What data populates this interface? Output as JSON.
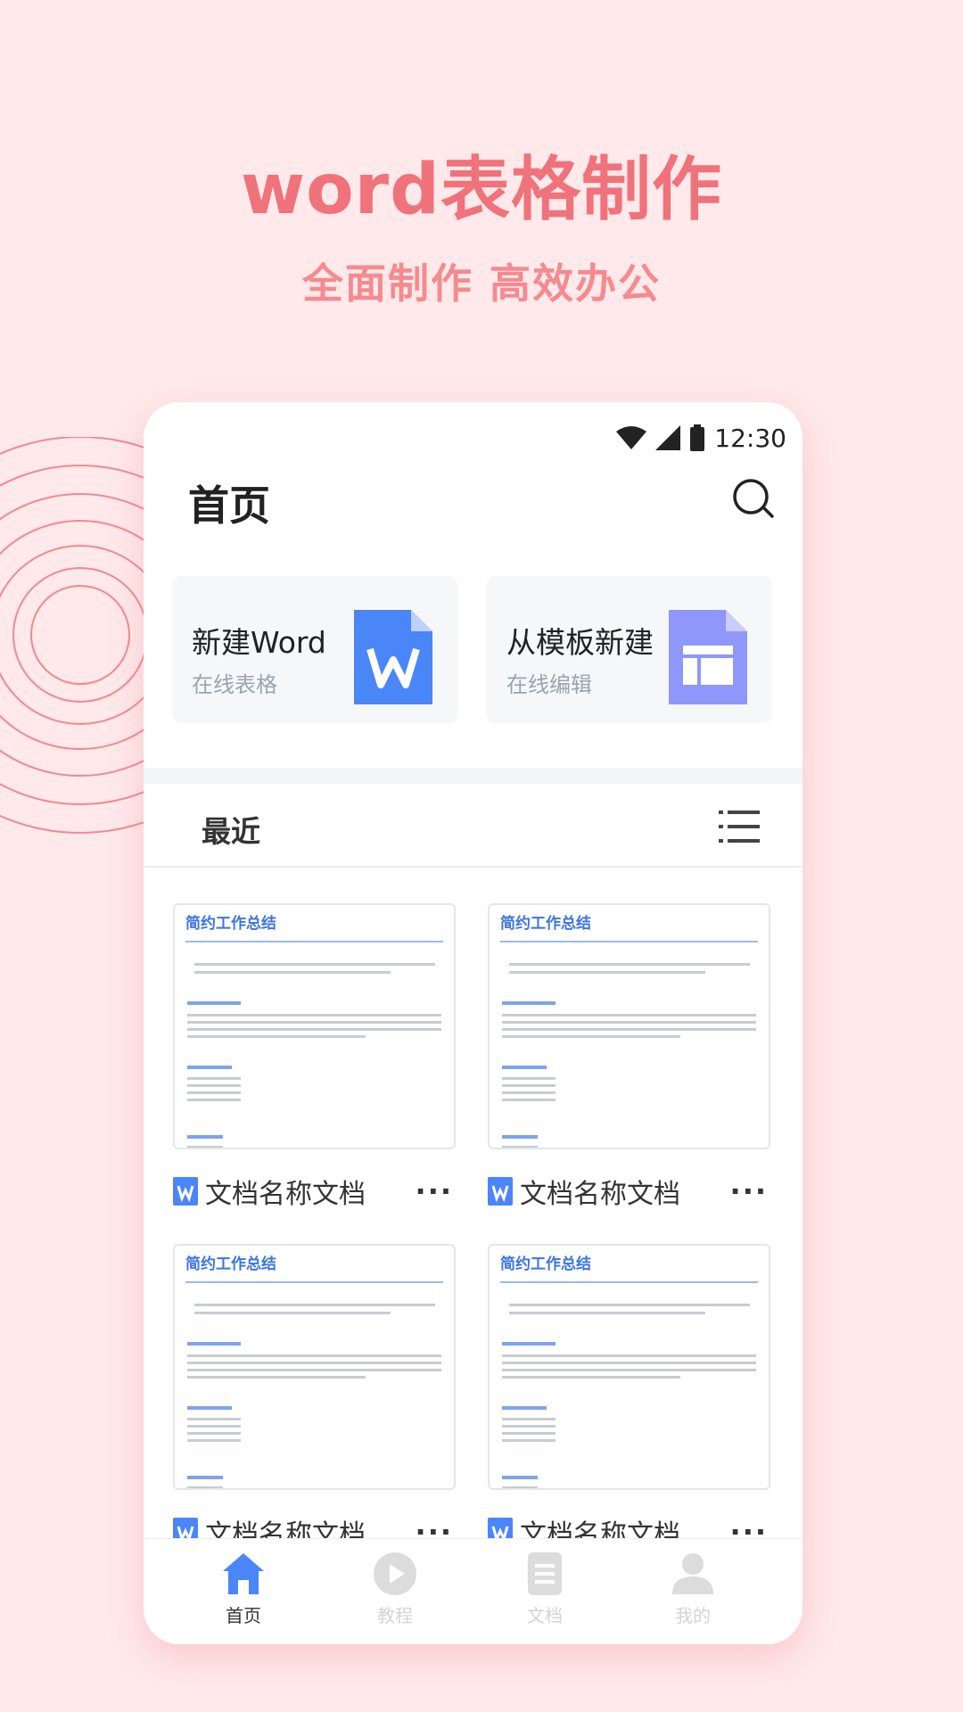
{
  "promo": {
    "headline": "word表格制作",
    "subline": "全面制作 高效办公",
    "accent_color": "#f0727a"
  },
  "status_bar": {
    "time": "12:30",
    "icons": [
      "wifi-icon",
      "signal-icon",
      "battery-icon"
    ]
  },
  "header": {
    "title": "首页",
    "search_icon": "search-icon"
  },
  "quick_actions": [
    {
      "title": "新建Word",
      "subtitle": "在线表格",
      "icon": "word-doc-icon",
      "icon_color": "#4a86f7"
    },
    {
      "title": "从模板新建",
      "subtitle": "在线编辑",
      "icon": "template-doc-icon",
      "icon_color": "#8f97fb"
    }
  ],
  "recent": {
    "label": "最近",
    "view_icon": "list-view-icon"
  },
  "documents": [
    {
      "name": "文档名称文档",
      "preview_title": "简约工作总结",
      "more": "···"
    },
    {
      "name": "文档名称文档",
      "preview_title": "简约工作总结",
      "more": "···"
    },
    {
      "name": "文档名称文档",
      "preview_title": "简约工作总结",
      "more": "···"
    },
    {
      "name": "文档名称文档",
      "preview_title": "简约工作总结",
      "more": "···"
    }
  ],
  "tabs": [
    {
      "label": "首页",
      "icon": "home-icon",
      "active": true,
      "color": "#4a86f7"
    },
    {
      "label": "教程",
      "icon": "play-icon",
      "active": false,
      "color": "#d9d9d9"
    },
    {
      "label": "文档",
      "icon": "document-icon",
      "active": false,
      "color": "#d9d9d9"
    },
    {
      "label": "我的",
      "icon": "user-icon",
      "active": false,
      "color": "#d9d9d9"
    }
  ]
}
